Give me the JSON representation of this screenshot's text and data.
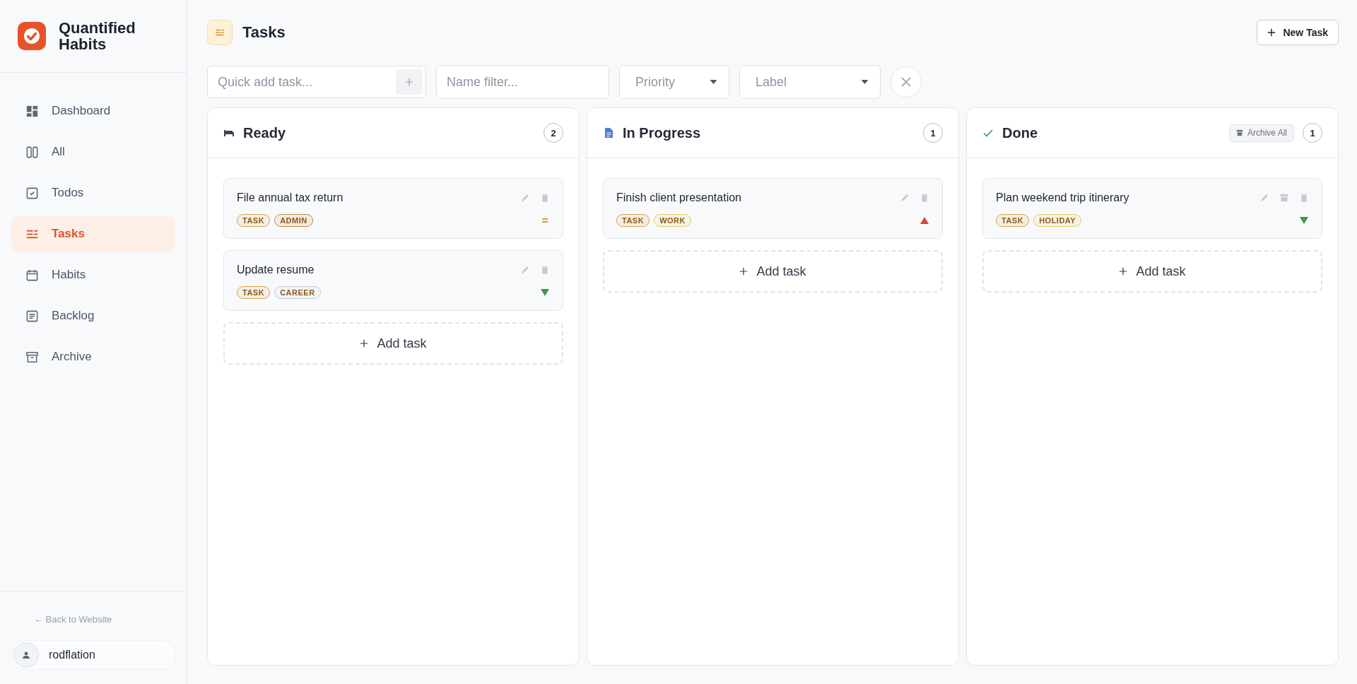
{
  "app": {
    "name": "Quantified Habits"
  },
  "sidebar": {
    "items": [
      {
        "label": "Dashboard",
        "selected": false
      },
      {
        "label": "All",
        "selected": false
      },
      {
        "label": "Todos",
        "selected": false
      },
      {
        "label": "Tasks",
        "selected": true
      },
      {
        "label": "Habits",
        "selected": false
      },
      {
        "label": "Backlog",
        "selected": false
      },
      {
        "label": "Archive",
        "selected": false
      }
    ],
    "back_link": "← Back to Website",
    "user": "rodflation"
  },
  "page": {
    "title": "Tasks",
    "new_button": "New Task"
  },
  "filters": {
    "quick_add": {
      "placeholder": "Quick add task..."
    },
    "name_filter": {
      "placeholder": "Name filter..."
    },
    "priority": {
      "placeholder": "Priority"
    },
    "label": {
      "placeholder": "Label"
    }
  },
  "columns": [
    {
      "title": "Ready",
      "count": "2",
      "add_label": "Add task",
      "cards": [
        {
          "title": "File annual tax return",
          "archive_action": false,
          "kind": "medium",
          "tags": [
            {
              "text": "TASK",
              "color": "#d9a441"
            },
            {
              "text": "ADMIN",
              "color": "#c58a3a"
            }
          ]
        },
        {
          "title": "Update resume",
          "archive_action": false,
          "kind": "low",
          "tags": [
            {
              "text": "TASK",
              "color": "#d9a441"
            },
            {
              "text": "CAREER",
              "color": "#c9ccd2"
            }
          ]
        }
      ]
    },
    {
      "title": "In Progress",
      "count": "1",
      "add_label": "Add task",
      "cards": [
        {
          "title": "Finish client presentation",
          "archive_action": false,
          "kind": "high",
          "tags": [
            {
              "text": "TASK",
              "color": "#d9a441"
            },
            {
              "text": "WORK",
              "color": "#e6cf5a"
            }
          ]
        }
      ]
    },
    {
      "title": "Done",
      "count": "1",
      "header_button": "Archive All",
      "add_label": "Add task",
      "cards": [
        {
          "title": "Plan weekend trip itinerary",
          "archive_action": true,
          "kind": "low",
          "tags": [
            {
              "text": "TASK",
              "color": "#d9a441"
            },
            {
              "text": "HOLIDAY",
              "color": "#e6cf5a"
            }
          ]
        }
      ]
    }
  ]
}
